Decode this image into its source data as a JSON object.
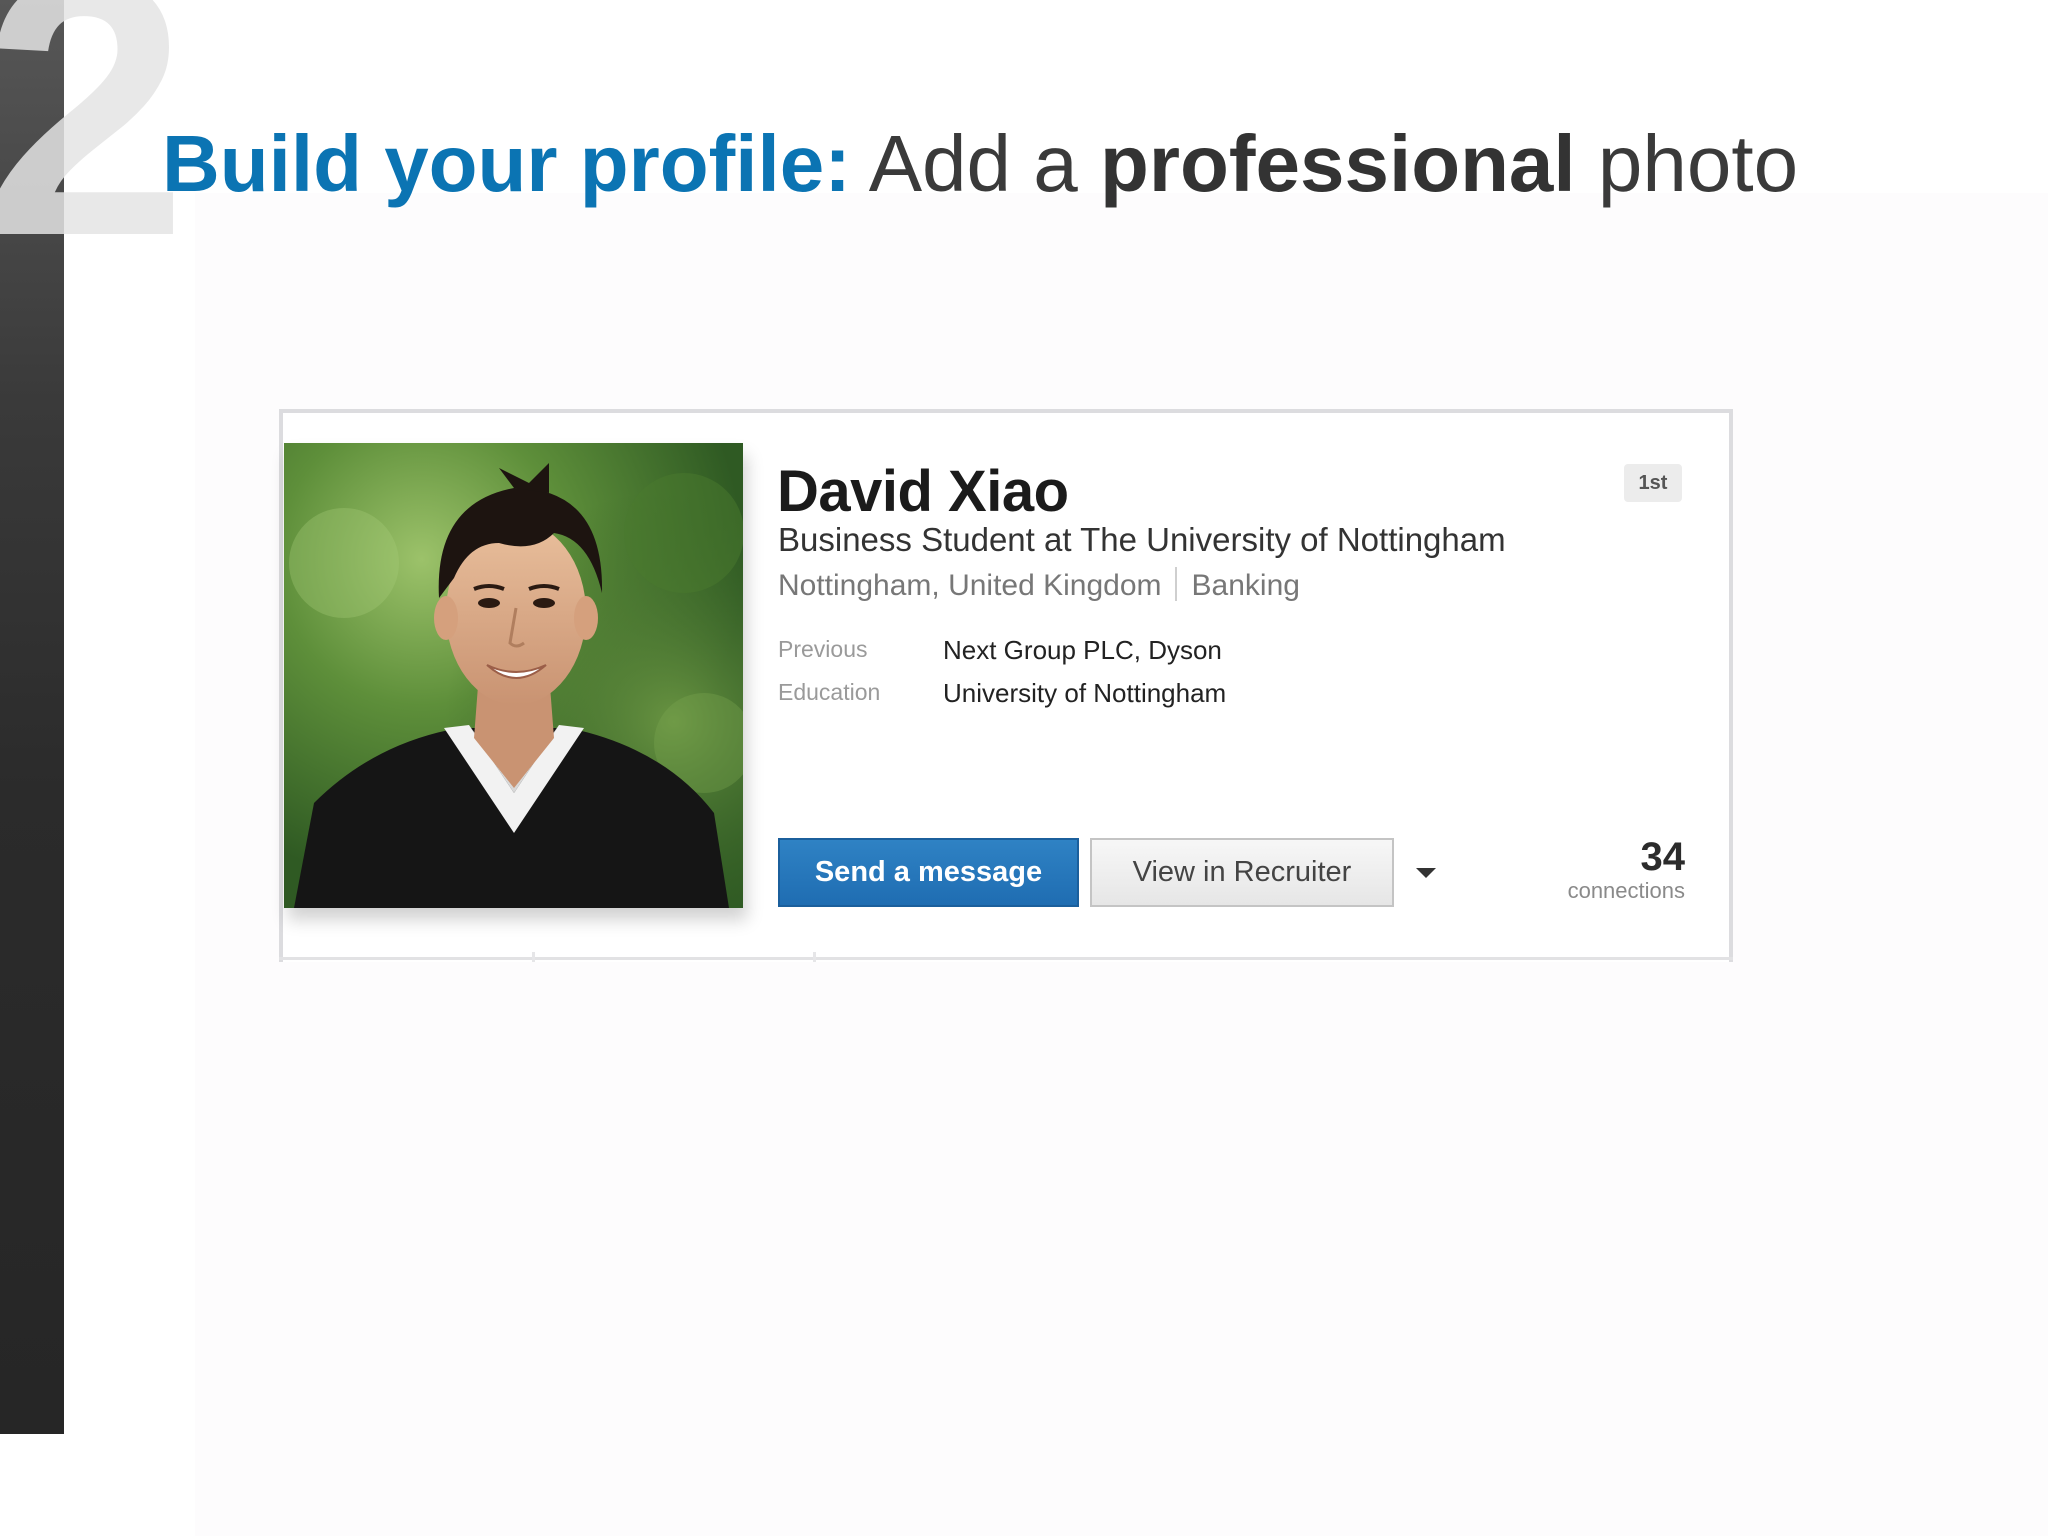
{
  "slide": {
    "number": "2",
    "title_accent": "Build your profile:",
    "title_part1": "Add a",
    "title_bold": "professional",
    "title_part2": "photo"
  },
  "profile": {
    "name": "David Xiao",
    "connection_degree": "1st",
    "headline": "Business Student at The University of Nottingham",
    "location": "Nottingham, United Kingdom",
    "industry": "Banking",
    "rows": [
      {
        "label": "Previous",
        "value": "Next Group PLC, Dyson"
      },
      {
        "label": "Education",
        "value": "University of Nottingham"
      }
    ],
    "send_message_label": "Send a message",
    "view_recruiter_label": "View in Recruiter",
    "connections_count": "34",
    "connections_label": "connections"
  },
  "colors": {
    "accent": "#0b74b3",
    "primary_button": "#1f6db2"
  },
  "icons": {
    "dropdown": "chevron-down-icon"
  }
}
